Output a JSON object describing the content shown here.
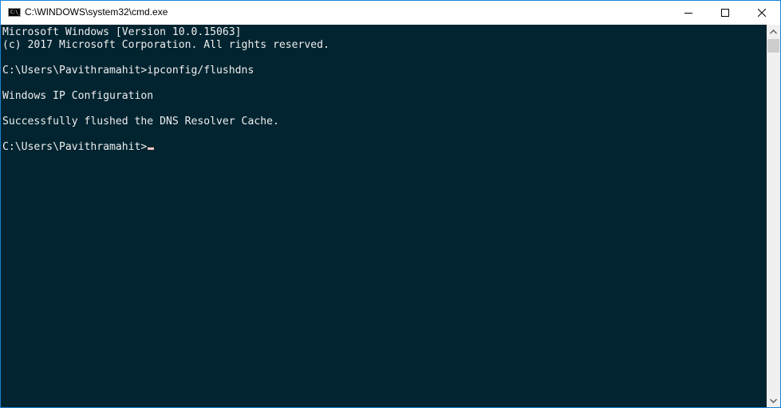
{
  "window": {
    "title": "C:\\WINDOWS\\system32\\cmd.exe",
    "icon": "cmd-icon",
    "icon_text": "C:\\_",
    "border_color": "#1883d7",
    "controls": [
      "minimize-icon",
      "maximize-icon",
      "close-icon"
    ]
  },
  "console": {
    "background": "#012430",
    "foreground": "#eeeeee",
    "lines": [
      "Microsoft Windows [Version 10.0.15063]",
      "(c) 2017 Microsoft Corporation. All rights reserved.",
      "",
      "C:\\Users\\Pavithramahit>ipconfig/flushdns",
      "",
      "Windows IP Configuration",
      "",
      "Successfully flushed the DNS Resolver Cache.",
      "",
      "C:\\Users\\Pavithramahit>"
    ]
  },
  "scrollbar": {
    "up_icon": "chevron-up-icon",
    "down_icon": "chevron-down-icon"
  }
}
